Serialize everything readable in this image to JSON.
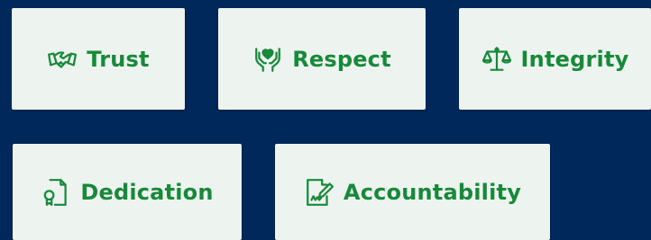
{
  "background_color": "#00285a",
  "card_color": "#edf3ef",
  "accent_color": "#178a3a",
  "values": [
    {
      "label": "Trust",
      "icon": "handshake-icon"
    },
    {
      "label": "Respect",
      "icon": "heart-in-hands-icon"
    },
    {
      "label": "Integrity",
      "icon": "balance-scale-icon"
    },
    {
      "label": "Dedication",
      "icon": "certificate-icon"
    },
    {
      "label": "Accountability",
      "icon": "signed-document-icon"
    }
  ]
}
